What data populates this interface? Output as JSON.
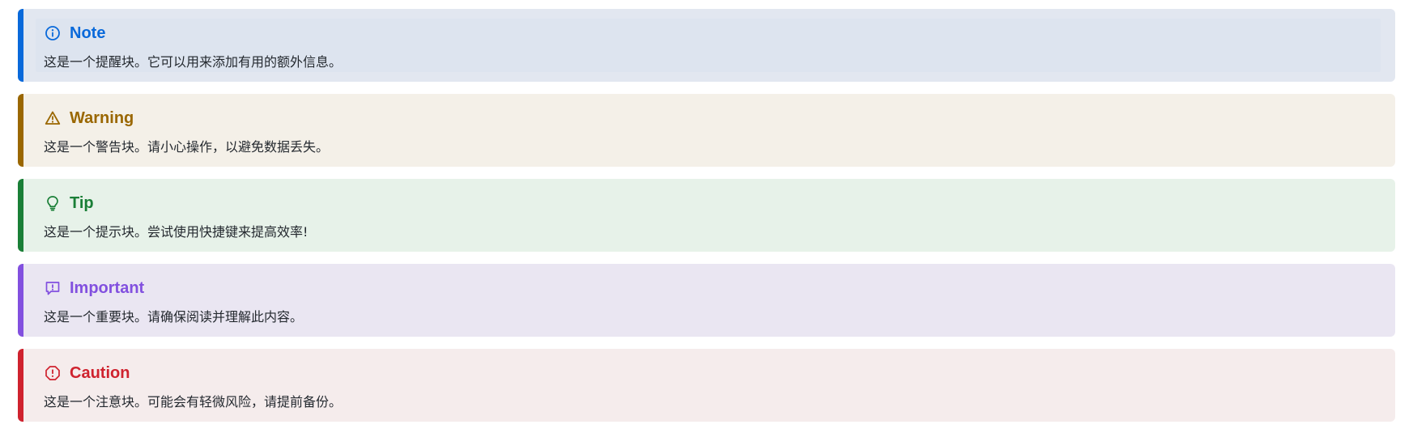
{
  "callouts": [
    {
      "type": "note",
      "icon": "info-icon",
      "title": "Note",
      "body": "这是一个提醒块。它可以用来添加有用的额外信息。",
      "accent": "#0969da",
      "background": "#e2e7f0"
    },
    {
      "type": "warning",
      "icon": "alert-triangle-icon",
      "title": "Warning",
      "body": "这是一个警告块。请小心操作，以避免数据丢失。",
      "accent": "#9a6700",
      "background": "#f4f0e8"
    },
    {
      "type": "tip",
      "icon": "lightbulb-icon",
      "title": "Tip",
      "body": "这是一个提示块。尝试使用快捷键来提高效率!",
      "accent": "#1a7f37",
      "background": "#e7f2e9"
    },
    {
      "type": "important",
      "icon": "report-icon",
      "title": "Important",
      "body": "这是一个重要块。请确保阅读并理解此内容。",
      "accent": "#8250df",
      "background": "#eae6f2"
    },
    {
      "type": "caution",
      "icon": "stop-icon",
      "title": "Caution",
      "body": "这是一个注意块。可能会有轻微风险，请提前备份。",
      "accent": "#cf222e",
      "background": "#f5ecec"
    }
  ]
}
